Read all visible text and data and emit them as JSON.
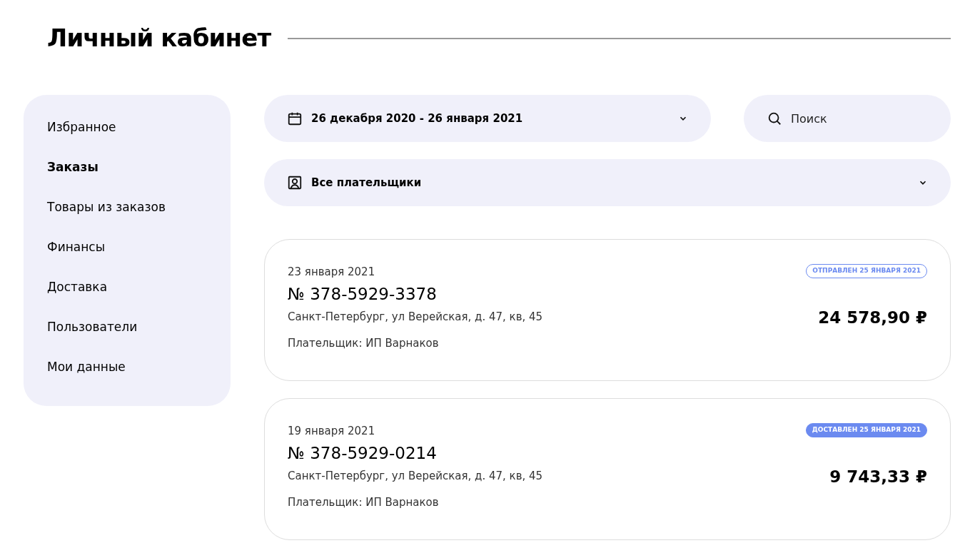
{
  "page_title": "Личный кабинет",
  "sidebar": {
    "items": [
      {
        "label": "Избранное",
        "selected": false
      },
      {
        "label": "Заказы",
        "selected": true
      },
      {
        "label": "Товары из заказов",
        "selected": false
      },
      {
        "label": "Финансы",
        "selected": false
      },
      {
        "label": "Доставка",
        "selected": false
      },
      {
        "label": "Пользователи",
        "selected": false
      },
      {
        "label": "Мои данные",
        "selected": false
      }
    ]
  },
  "filters": {
    "date_range": "26 декабря 2020 - 26 января 2021",
    "search": {
      "placeholder": "Поиск"
    },
    "payer": "Все плательщики"
  },
  "orders": [
    {
      "date": "23 января 2021",
      "number": "№ 378-5929-3378",
      "address": "Санкт-Петербург, ул Верейская, д. 47, кв, 45",
      "payer": "Плательщик: ИП Варнаков",
      "status": {
        "kind": "shipped",
        "label": "ОТПРАВЛЕН 25 ЯНВАРЯ 2021"
      },
      "total": "24 578,90 ₽"
    },
    {
      "date": "19 января 2021",
      "number": "№ 378-5929-0214",
      "address": "Санкт-Петербург, ул Верейская, д. 47, кв, 45",
      "payer": "Плательщик: ИП Варнаков",
      "status": {
        "kind": "delivered",
        "label": "ДОСТАВЛЕН 25 ЯНВАРЯ 2021"
      },
      "total": "9 743,33 ₽"
    }
  ]
}
